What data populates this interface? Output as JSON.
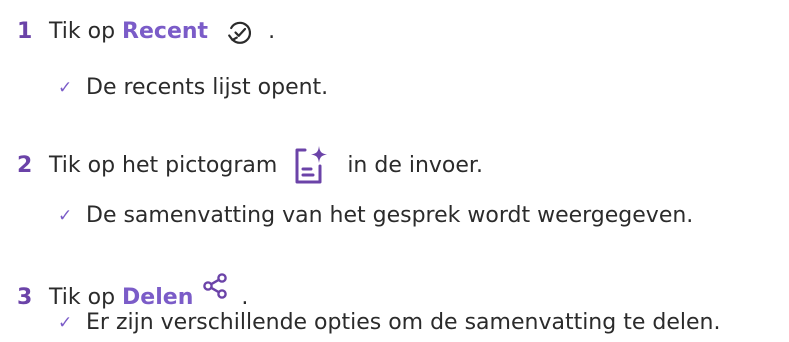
{
  "steps": [
    {
      "number": "1",
      "prefix": "Tik op",
      "keyword": "Recent",
      "suffix": ".",
      "icon": "history-check-icon",
      "result": "De recents lijst opent."
    },
    {
      "number": "2",
      "prefix": "Tik op het pictogram",
      "keyword": "",
      "suffix": "in de invoer.",
      "icon": "ai-summary-icon",
      "result": "De samenvatting van het gesprek wordt weergegeven."
    },
    {
      "number": "3",
      "prefix": "Tik op",
      "keyword": "Delen",
      "suffix": ".",
      "icon": "share-icon",
      "result": "Er zijn verschillende opties om de samenvatting te delen."
    }
  ],
  "check_symbol": "✓",
  "colors": {
    "accent": "#7b5cc8",
    "number": "#6b43a8",
    "text": "#2b2b2b"
  }
}
